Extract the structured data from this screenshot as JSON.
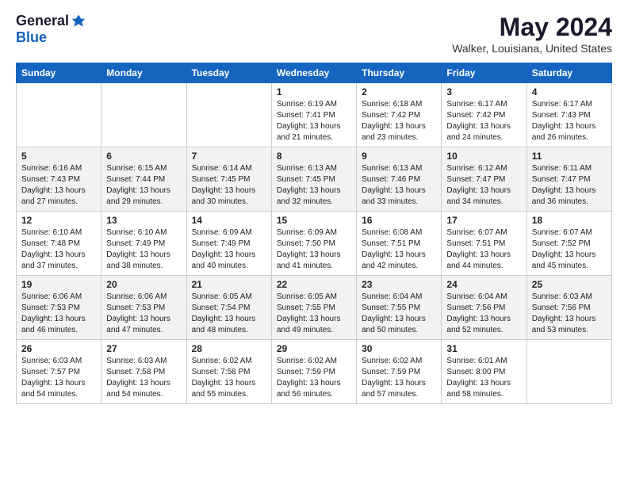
{
  "header": {
    "logo_general": "General",
    "logo_blue": "Blue",
    "month_title": "May 2024",
    "location": "Walker, Louisiana, United States"
  },
  "weekdays": [
    "Sunday",
    "Monday",
    "Tuesday",
    "Wednesday",
    "Thursday",
    "Friday",
    "Saturday"
  ],
  "weeks": [
    [
      {
        "day": "",
        "info": ""
      },
      {
        "day": "",
        "info": ""
      },
      {
        "day": "",
        "info": ""
      },
      {
        "day": "1",
        "info": "Sunrise: 6:19 AM\nSunset: 7:41 PM\nDaylight: 13 hours\nand 21 minutes."
      },
      {
        "day": "2",
        "info": "Sunrise: 6:18 AM\nSunset: 7:42 PM\nDaylight: 13 hours\nand 23 minutes."
      },
      {
        "day": "3",
        "info": "Sunrise: 6:17 AM\nSunset: 7:42 PM\nDaylight: 13 hours\nand 24 minutes."
      },
      {
        "day": "4",
        "info": "Sunrise: 6:17 AM\nSunset: 7:43 PM\nDaylight: 13 hours\nand 26 minutes."
      }
    ],
    [
      {
        "day": "5",
        "info": "Sunrise: 6:16 AM\nSunset: 7:43 PM\nDaylight: 13 hours\nand 27 minutes."
      },
      {
        "day": "6",
        "info": "Sunrise: 6:15 AM\nSunset: 7:44 PM\nDaylight: 13 hours\nand 29 minutes."
      },
      {
        "day": "7",
        "info": "Sunrise: 6:14 AM\nSunset: 7:45 PM\nDaylight: 13 hours\nand 30 minutes."
      },
      {
        "day": "8",
        "info": "Sunrise: 6:13 AM\nSunset: 7:45 PM\nDaylight: 13 hours\nand 32 minutes."
      },
      {
        "day": "9",
        "info": "Sunrise: 6:13 AM\nSunset: 7:46 PM\nDaylight: 13 hours\nand 33 minutes."
      },
      {
        "day": "10",
        "info": "Sunrise: 6:12 AM\nSunset: 7:47 PM\nDaylight: 13 hours\nand 34 minutes."
      },
      {
        "day": "11",
        "info": "Sunrise: 6:11 AM\nSunset: 7:47 PM\nDaylight: 13 hours\nand 36 minutes."
      }
    ],
    [
      {
        "day": "12",
        "info": "Sunrise: 6:10 AM\nSunset: 7:48 PM\nDaylight: 13 hours\nand 37 minutes."
      },
      {
        "day": "13",
        "info": "Sunrise: 6:10 AM\nSunset: 7:49 PM\nDaylight: 13 hours\nand 38 minutes."
      },
      {
        "day": "14",
        "info": "Sunrise: 6:09 AM\nSunset: 7:49 PM\nDaylight: 13 hours\nand 40 minutes."
      },
      {
        "day": "15",
        "info": "Sunrise: 6:09 AM\nSunset: 7:50 PM\nDaylight: 13 hours\nand 41 minutes."
      },
      {
        "day": "16",
        "info": "Sunrise: 6:08 AM\nSunset: 7:51 PM\nDaylight: 13 hours\nand 42 minutes."
      },
      {
        "day": "17",
        "info": "Sunrise: 6:07 AM\nSunset: 7:51 PM\nDaylight: 13 hours\nand 44 minutes."
      },
      {
        "day": "18",
        "info": "Sunrise: 6:07 AM\nSunset: 7:52 PM\nDaylight: 13 hours\nand 45 minutes."
      }
    ],
    [
      {
        "day": "19",
        "info": "Sunrise: 6:06 AM\nSunset: 7:53 PM\nDaylight: 13 hours\nand 46 minutes."
      },
      {
        "day": "20",
        "info": "Sunrise: 6:06 AM\nSunset: 7:53 PM\nDaylight: 13 hours\nand 47 minutes."
      },
      {
        "day": "21",
        "info": "Sunrise: 6:05 AM\nSunset: 7:54 PM\nDaylight: 13 hours\nand 48 minutes."
      },
      {
        "day": "22",
        "info": "Sunrise: 6:05 AM\nSunset: 7:55 PM\nDaylight: 13 hours\nand 49 minutes."
      },
      {
        "day": "23",
        "info": "Sunrise: 6:04 AM\nSunset: 7:55 PM\nDaylight: 13 hours\nand 50 minutes."
      },
      {
        "day": "24",
        "info": "Sunrise: 6:04 AM\nSunset: 7:56 PM\nDaylight: 13 hours\nand 52 minutes."
      },
      {
        "day": "25",
        "info": "Sunrise: 6:03 AM\nSunset: 7:56 PM\nDaylight: 13 hours\nand 53 minutes."
      }
    ],
    [
      {
        "day": "26",
        "info": "Sunrise: 6:03 AM\nSunset: 7:57 PM\nDaylight: 13 hours\nand 54 minutes."
      },
      {
        "day": "27",
        "info": "Sunrise: 6:03 AM\nSunset: 7:58 PM\nDaylight: 13 hours\nand 54 minutes."
      },
      {
        "day": "28",
        "info": "Sunrise: 6:02 AM\nSunset: 7:58 PM\nDaylight: 13 hours\nand 55 minutes."
      },
      {
        "day": "29",
        "info": "Sunrise: 6:02 AM\nSunset: 7:59 PM\nDaylight: 13 hours\nand 56 minutes."
      },
      {
        "day": "30",
        "info": "Sunrise: 6:02 AM\nSunset: 7:59 PM\nDaylight: 13 hours\nand 57 minutes."
      },
      {
        "day": "31",
        "info": "Sunrise: 6:01 AM\nSunset: 8:00 PM\nDaylight: 13 hours\nand 58 minutes."
      },
      {
        "day": "",
        "info": ""
      }
    ]
  ]
}
